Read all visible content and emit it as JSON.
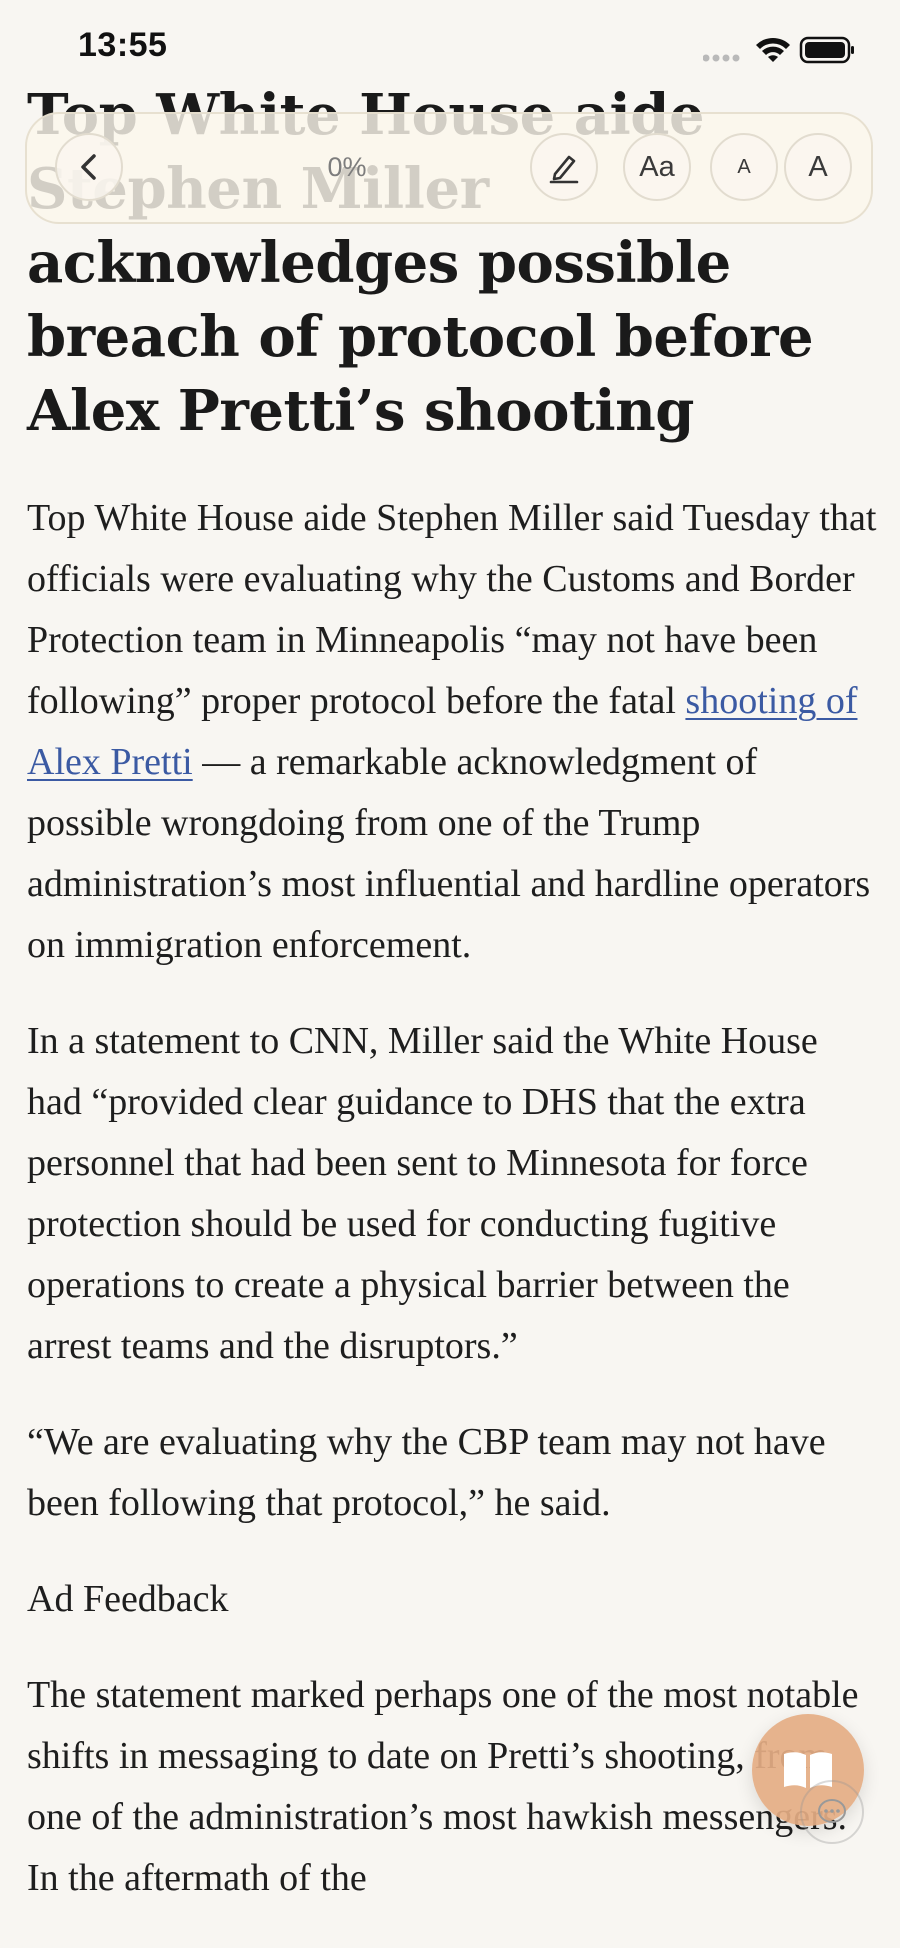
{
  "status_bar": {
    "time": "13:55",
    "icons": [
      "signal-dots-icon",
      "wifi-icon",
      "battery-icon"
    ]
  },
  "toolbar": {
    "progress": "0%",
    "font_size_label": "Aa",
    "smaller_label": "A",
    "larger_label": "A",
    "icons": [
      "back-chevron-icon",
      "pencil-icon"
    ]
  },
  "article": {
    "headline": "Top White House aide Stephen Miller acknowledges possible breach of protocol before Alex Pretti’s shooting",
    "p1_before_link": "Top White House aide Stephen Miller said Tuesday that officials were evaluating why the Customs and Border Protection team in Minneapolis “may not have been following” proper protocol before the fatal ",
    "p1_link": "shooting of Alex Pretti",
    "p1_after_link": " — a remarkable acknowledgment of possible wrongdoing from one of the Trump administration’s most influential and hardline operators on immigration enforcement.",
    "p2": "In a statement to CNN, Miller said the White House had “provided clear guidance to DHS that the extra personnel that had been sent to Minnesota for force protection should be used for conducting fugitive operations to create a physical barrier between the arrest teams and the disruptors.”",
    "p3": "“We are evaluating why the CBP team may not have been following that protocol,” he said.",
    "ad_feedback": "Ad Feedback",
    "p4": "The statement marked perhaps one of the most notable shifts in messaging to date on Pretti’s shooting, from one of the administration’s most hawkish messengers. In the aftermath of the"
  },
  "floating": {
    "icons": [
      "reader-book-icon",
      "chat-bubble-icon"
    ],
    "colors": {
      "fab": "#e4ac84"
    }
  },
  "colors": {
    "background": "#f8f6f2",
    "link": "#3b5aa3",
    "text": "#1e1e1e"
  }
}
